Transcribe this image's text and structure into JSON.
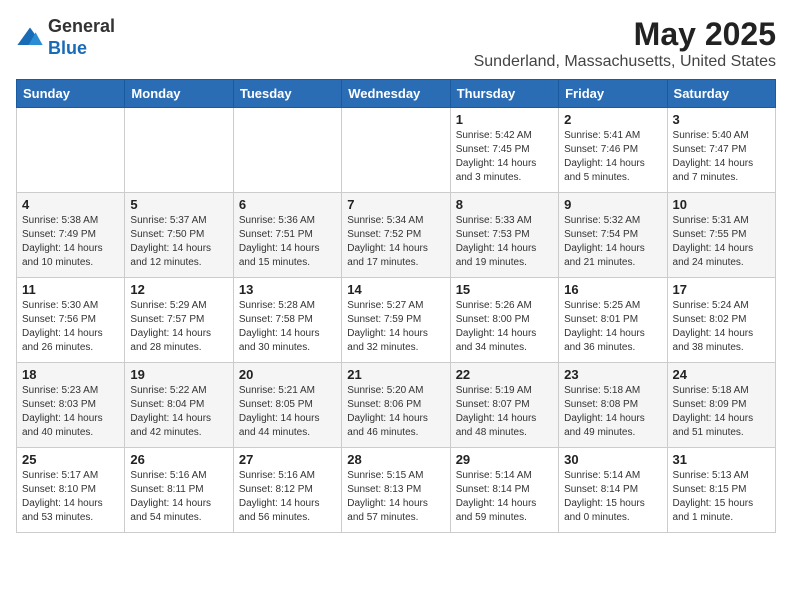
{
  "header": {
    "logo_line1": "General",
    "logo_line2": "Blue",
    "month_title": "May 2025",
    "location": "Sunderland, Massachusetts, United States"
  },
  "days_of_week": [
    "Sunday",
    "Monday",
    "Tuesday",
    "Wednesday",
    "Thursday",
    "Friday",
    "Saturday"
  ],
  "weeks": [
    [
      {
        "day": "",
        "info": ""
      },
      {
        "day": "",
        "info": ""
      },
      {
        "day": "",
        "info": ""
      },
      {
        "day": "",
        "info": ""
      },
      {
        "day": "1",
        "info": "Sunrise: 5:42 AM\nSunset: 7:45 PM\nDaylight: 14 hours\nand 3 minutes."
      },
      {
        "day": "2",
        "info": "Sunrise: 5:41 AM\nSunset: 7:46 PM\nDaylight: 14 hours\nand 5 minutes."
      },
      {
        "day": "3",
        "info": "Sunrise: 5:40 AM\nSunset: 7:47 PM\nDaylight: 14 hours\nand 7 minutes."
      }
    ],
    [
      {
        "day": "4",
        "info": "Sunrise: 5:38 AM\nSunset: 7:49 PM\nDaylight: 14 hours\nand 10 minutes."
      },
      {
        "day": "5",
        "info": "Sunrise: 5:37 AM\nSunset: 7:50 PM\nDaylight: 14 hours\nand 12 minutes."
      },
      {
        "day": "6",
        "info": "Sunrise: 5:36 AM\nSunset: 7:51 PM\nDaylight: 14 hours\nand 15 minutes."
      },
      {
        "day": "7",
        "info": "Sunrise: 5:34 AM\nSunset: 7:52 PM\nDaylight: 14 hours\nand 17 minutes."
      },
      {
        "day": "8",
        "info": "Sunrise: 5:33 AM\nSunset: 7:53 PM\nDaylight: 14 hours\nand 19 minutes."
      },
      {
        "day": "9",
        "info": "Sunrise: 5:32 AM\nSunset: 7:54 PM\nDaylight: 14 hours\nand 21 minutes."
      },
      {
        "day": "10",
        "info": "Sunrise: 5:31 AM\nSunset: 7:55 PM\nDaylight: 14 hours\nand 24 minutes."
      }
    ],
    [
      {
        "day": "11",
        "info": "Sunrise: 5:30 AM\nSunset: 7:56 PM\nDaylight: 14 hours\nand 26 minutes."
      },
      {
        "day": "12",
        "info": "Sunrise: 5:29 AM\nSunset: 7:57 PM\nDaylight: 14 hours\nand 28 minutes."
      },
      {
        "day": "13",
        "info": "Sunrise: 5:28 AM\nSunset: 7:58 PM\nDaylight: 14 hours\nand 30 minutes."
      },
      {
        "day": "14",
        "info": "Sunrise: 5:27 AM\nSunset: 7:59 PM\nDaylight: 14 hours\nand 32 minutes."
      },
      {
        "day": "15",
        "info": "Sunrise: 5:26 AM\nSunset: 8:00 PM\nDaylight: 14 hours\nand 34 minutes."
      },
      {
        "day": "16",
        "info": "Sunrise: 5:25 AM\nSunset: 8:01 PM\nDaylight: 14 hours\nand 36 minutes."
      },
      {
        "day": "17",
        "info": "Sunrise: 5:24 AM\nSunset: 8:02 PM\nDaylight: 14 hours\nand 38 minutes."
      }
    ],
    [
      {
        "day": "18",
        "info": "Sunrise: 5:23 AM\nSunset: 8:03 PM\nDaylight: 14 hours\nand 40 minutes."
      },
      {
        "day": "19",
        "info": "Sunrise: 5:22 AM\nSunset: 8:04 PM\nDaylight: 14 hours\nand 42 minutes."
      },
      {
        "day": "20",
        "info": "Sunrise: 5:21 AM\nSunset: 8:05 PM\nDaylight: 14 hours\nand 44 minutes."
      },
      {
        "day": "21",
        "info": "Sunrise: 5:20 AM\nSunset: 8:06 PM\nDaylight: 14 hours\nand 46 minutes."
      },
      {
        "day": "22",
        "info": "Sunrise: 5:19 AM\nSunset: 8:07 PM\nDaylight: 14 hours\nand 48 minutes."
      },
      {
        "day": "23",
        "info": "Sunrise: 5:18 AM\nSunset: 8:08 PM\nDaylight: 14 hours\nand 49 minutes."
      },
      {
        "day": "24",
        "info": "Sunrise: 5:18 AM\nSunset: 8:09 PM\nDaylight: 14 hours\nand 51 minutes."
      }
    ],
    [
      {
        "day": "25",
        "info": "Sunrise: 5:17 AM\nSunset: 8:10 PM\nDaylight: 14 hours\nand 53 minutes."
      },
      {
        "day": "26",
        "info": "Sunrise: 5:16 AM\nSunset: 8:11 PM\nDaylight: 14 hours\nand 54 minutes."
      },
      {
        "day": "27",
        "info": "Sunrise: 5:16 AM\nSunset: 8:12 PM\nDaylight: 14 hours\nand 56 minutes."
      },
      {
        "day": "28",
        "info": "Sunrise: 5:15 AM\nSunset: 8:13 PM\nDaylight: 14 hours\nand 57 minutes."
      },
      {
        "day": "29",
        "info": "Sunrise: 5:14 AM\nSunset: 8:14 PM\nDaylight: 14 hours\nand 59 minutes."
      },
      {
        "day": "30",
        "info": "Sunrise: 5:14 AM\nSunset: 8:14 PM\nDaylight: 15 hours\nand 0 minutes."
      },
      {
        "day": "31",
        "info": "Sunrise: 5:13 AM\nSunset: 8:15 PM\nDaylight: 15 hours\nand 1 minute."
      }
    ]
  ]
}
